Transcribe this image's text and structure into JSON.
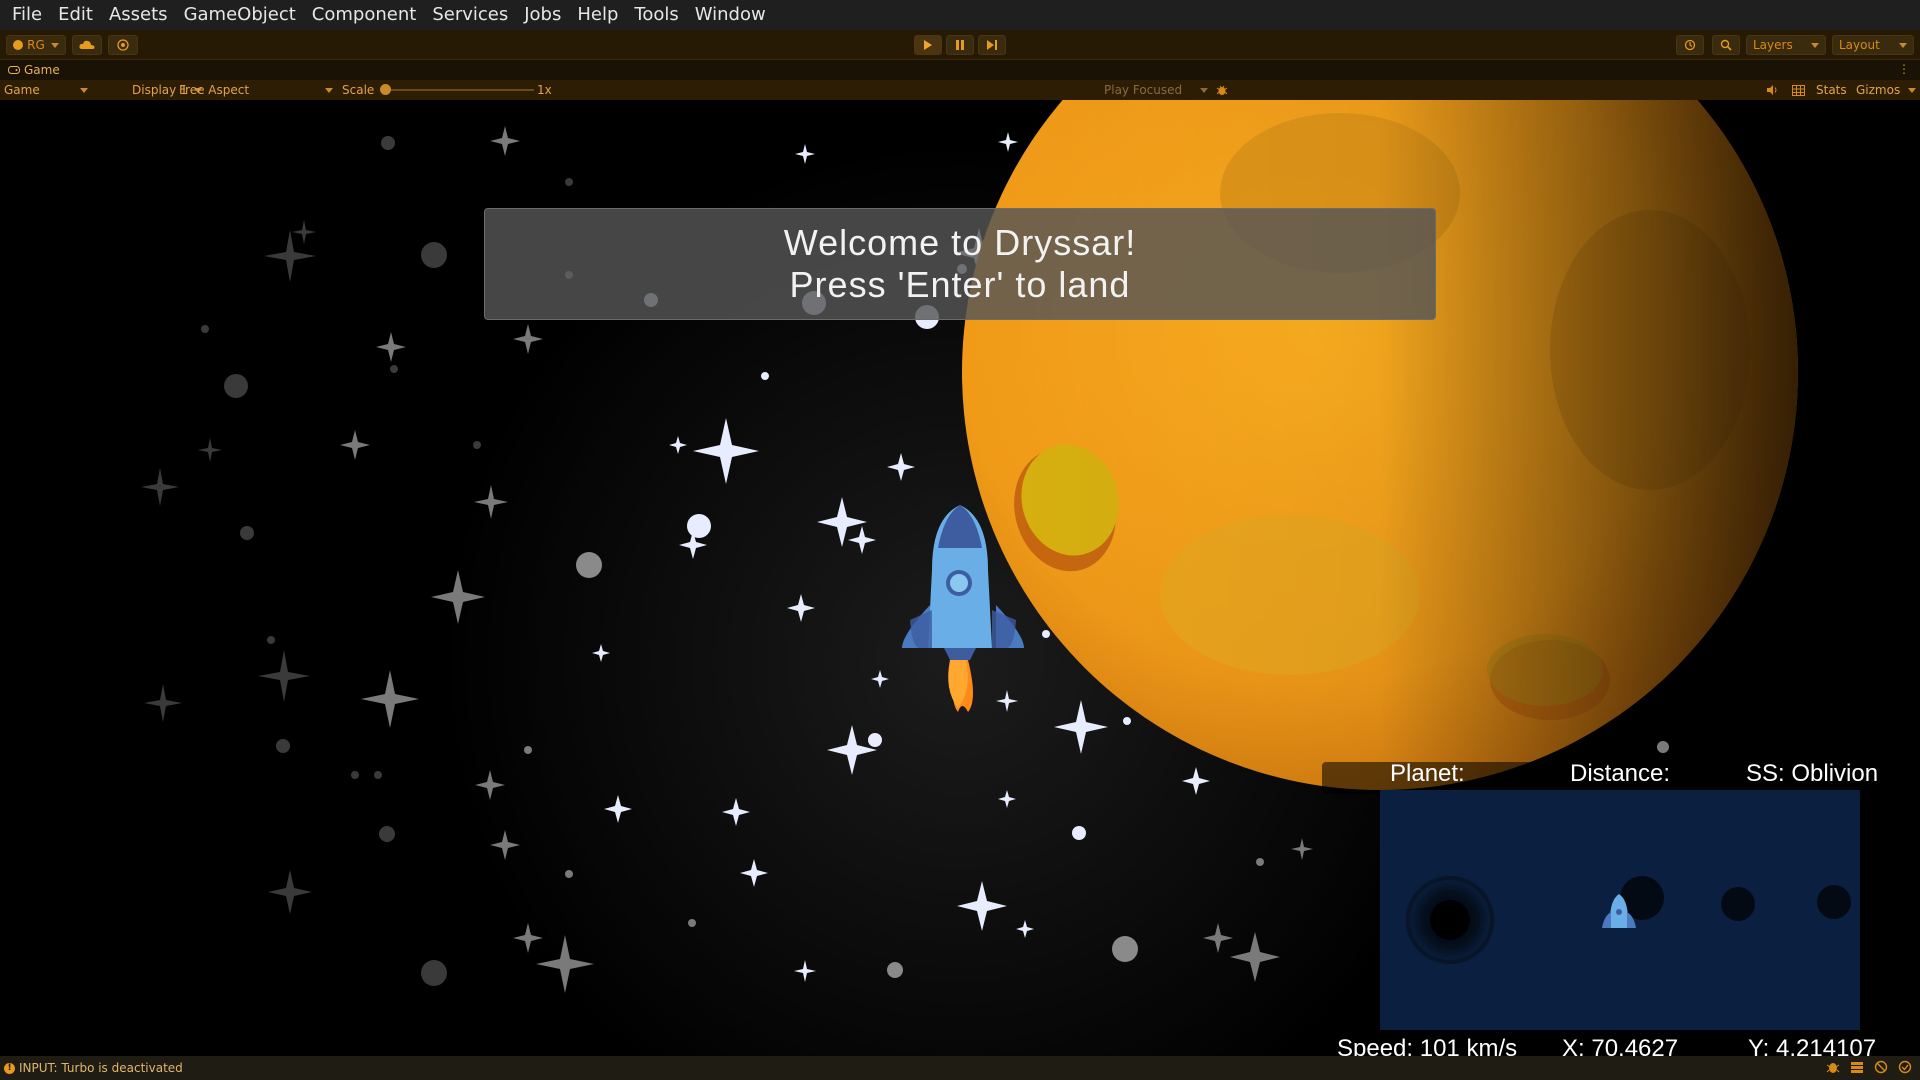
{
  "menu": [
    "File",
    "Edit",
    "Assets",
    "GameObject",
    "Component",
    "Services",
    "Jobs",
    "Help",
    "Tools",
    "Window"
  ],
  "toolbar": {
    "account_label": "RG",
    "layers_label": "Layers",
    "layout_label": "Layout"
  },
  "game_tab": {
    "label": "Game"
  },
  "game_bar": {
    "view_mode": "Game",
    "display": "Display 1",
    "aspect": "Free Aspect",
    "scale_label": "Scale",
    "scale_value": "1x",
    "play_mode": "Play Focused",
    "stats_label": "Stats",
    "gizmos_label": "Gizmos"
  },
  "hud": {
    "welcome_line1": "Welcome to Dryssar!",
    "welcome_line2": "Press 'Enter' to land",
    "planet_label": "Planet:",
    "distance_label": "Distance:",
    "ship_label": "SS: Oblivion",
    "speed": "Speed: 101 km/s",
    "x_coord": "X: 70.4627",
    "y_coord": "Y: 4.214107"
  },
  "status": {
    "message": "INPUT: Turbo is deactivated"
  },
  "colors": {
    "accent": "#e69a1e",
    "planet": "#f0a020",
    "minimap_bg": "#0b2040",
    "rocket_body": "#6aaee8"
  }
}
